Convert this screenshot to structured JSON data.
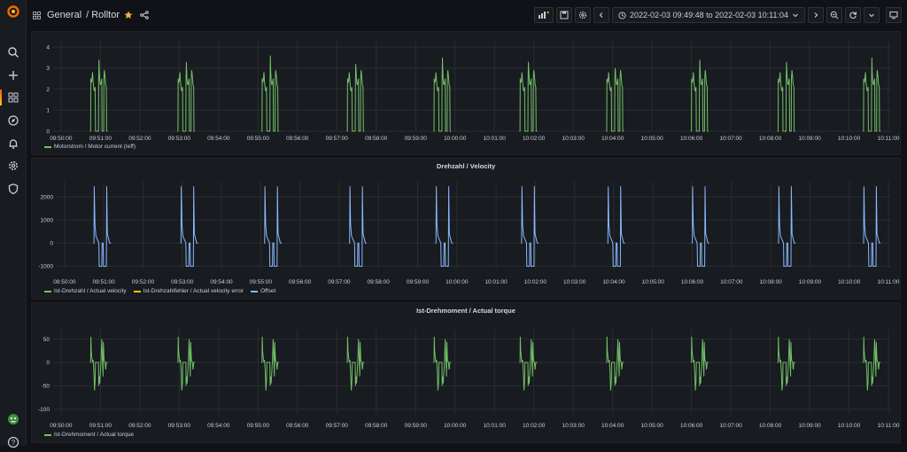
{
  "colors": {
    "green": "#73bf69",
    "yellow": "#f2cc0c",
    "blue": "#8ab8ff",
    "accent_star": "#f5b73b",
    "grid": "#2a2c31",
    "bg": "#181b1f"
  },
  "sidemenu": {
    "items": [
      {
        "icon": "grafana-logo-icon"
      },
      {
        "icon": "search-icon"
      },
      {
        "icon": "plus-icon"
      },
      {
        "icon": "dashboards-icon"
      },
      {
        "icon": "compass-icon"
      },
      {
        "icon": "bell-icon"
      },
      {
        "icon": "gear-icon"
      },
      {
        "icon": "shield-icon"
      },
      {
        "icon": "avatar-icon"
      },
      {
        "icon": "help-icon"
      }
    ]
  },
  "topbar": {
    "folder": "General",
    "separator": "/",
    "dashboard": "Rolltor",
    "time_range": "2022-02-03 09:49:48 to 2022-02-03 10:11:04"
  },
  "time_ticks": [
    "09:50:00",
    "09:51:00",
    "09:52:00",
    "09:53:00",
    "09:54:00",
    "09:55:00",
    "09:56:00",
    "09:57:00",
    "09:58:00",
    "09:59:00",
    "10:00:00",
    "10:01:00",
    "10:02:00",
    "10:03:00",
    "10:04:00",
    "10:05:00",
    "10:06:00",
    "10:07:00",
    "10:08:00",
    "10:09:00",
    "10:10:00",
    "10:11:00"
  ],
  "panels": [
    {
      "title": "",
      "legend": [
        {
          "label": "Motorstrom / Motor current (Ieff)",
          "color": "#73bf69"
        }
      ],
      "chart_data": {
        "type": "line",
        "x_range": [
          "09:49:48",
          "10:11:04"
        ],
        "ylim": [
          0,
          4.3
        ],
        "y_ticks": [
          0,
          1,
          2,
          3,
          4
        ],
        "cycle_starts": [
          "09:50:45",
          "09:52:58",
          "09:55:06",
          "09:57:16",
          "09:59:28",
          "10:01:39",
          "10:03:51",
          "10:06:00",
          "10:08:12",
          "10:10:22"
        ],
        "cycle_profile": {
          "type": "current",
          "peak": 2.8,
          "spikes": [
            3.4,
            3.3,
            3.6,
            3.2,
            3.5,
            3.3,
            3.0,
            3.4,
            3.3,
            3.5
          ],
          "on_level": 2.2
        },
        "series": [
          {
            "name": "Motorstrom / Motor current (Ieff)",
            "color": "#73bf69"
          }
        ]
      }
    },
    {
      "title": "Drehzahl / Velocity",
      "legend": [
        {
          "label": "Ist-Drehzahl / Actual velocity",
          "color": "#73bf69"
        },
        {
          "label": "Ist-Drehzahlfehler / Actual velocity error",
          "color": "#f2cc0c"
        },
        {
          "label": "Offset",
          "color": "#8ab8ff"
        }
      ],
      "chart_data": {
        "type": "line",
        "x_range": [
          "09:49:48",
          "10:11:04"
        ],
        "ylim": [
          -1100,
          2650
        ],
        "y_ticks": [
          -1000,
          0,
          1000,
          2000
        ],
        "cycle_starts": [
          "09:50:45",
          "09:52:58",
          "09:55:06",
          "09:57:16",
          "09:59:28",
          "10:01:39",
          "10:03:51",
          "10:06:00",
          "10:08:12",
          "10:10:22"
        ],
        "cycle_profile": {
          "type": "velocity",
          "up_peak": 2450,
          "down_level": -1000
        },
        "series": [
          {
            "name": "Ist-Drehzahl / Actual velocity",
            "color": "#73bf69"
          },
          {
            "name": "Ist-Drehzahlfehler / Actual velocity error",
            "color": "#f2cc0c"
          },
          {
            "name": "Offset",
            "color": "#8ab8ff"
          }
        ]
      }
    },
    {
      "title": "Ist-Drehmoment / Actual torque",
      "legend": [
        {
          "label": "Ist-Drehmoment / Actual torque",
          "color": "#73bf69"
        }
      ],
      "chart_data": {
        "type": "line",
        "x_range": [
          "09:49:48",
          "10:11:04"
        ],
        "ylim": [
          -110,
          70
        ],
        "y_ticks": [
          -100,
          -50,
          0,
          50
        ],
        "cycle_starts": [
          "09:50:45",
          "09:52:58",
          "09:55:06",
          "09:57:16",
          "09:59:28",
          "10:01:39",
          "10:03:51",
          "10:06:00",
          "10:08:12",
          "10:10:22"
        ],
        "cycle_profile": {
          "type": "torque",
          "high": 55,
          "low": -80
        },
        "series": [
          {
            "name": "Ist-Drehmoment / Actual torque",
            "color": "#73bf69"
          }
        ]
      }
    }
  ]
}
